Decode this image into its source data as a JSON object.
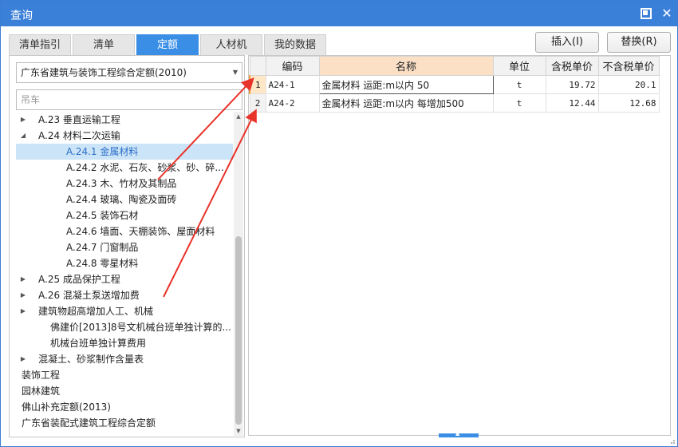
{
  "window": {
    "title": "查询"
  },
  "tabs": [
    {
      "label": "清单指引",
      "active": false
    },
    {
      "label": "清单",
      "active": false
    },
    {
      "label": "定额",
      "active": true
    },
    {
      "label": "人材机",
      "active": false
    },
    {
      "label": "我的数据",
      "active": false
    }
  ],
  "actions": {
    "insert_label": "插入(I)",
    "replace_label": "替换(R)"
  },
  "library": {
    "selected": "广东省建筑与装饰工程综合定额(2010)"
  },
  "search": {
    "value": "",
    "placeholder": "吊车"
  },
  "tree": [
    {
      "label": "A.23 垂直运输工程",
      "expander": "collapsed",
      "selected": false
    },
    {
      "label": "A.24 材料二次运输",
      "expander": "expanded",
      "selected": false
    },
    {
      "label": "A.24.1 金属材料",
      "expander": "none",
      "selected": true
    },
    {
      "label": "A.24.2 水泥、石灰、砂浆、砂、碎...",
      "expander": "none",
      "selected": false
    },
    {
      "label": "A.24.3 木、竹材及其制品",
      "expander": "none",
      "selected": false
    },
    {
      "label": "A.24.4 玻璃、陶瓷及面砖",
      "expander": "none",
      "selected": false
    },
    {
      "label": "A.24.5 装饰石材",
      "expander": "none",
      "selected": false
    },
    {
      "label": "A.24.6 墙面、天棚装饰、屋面材料",
      "expander": "none",
      "selected": false
    },
    {
      "label": "A.24.7 门窗制品",
      "expander": "none",
      "selected": false
    },
    {
      "label": "A.24.8 零星材料",
      "expander": "none",
      "selected": false
    },
    {
      "label": "A.25 成品保护工程",
      "expander": "collapsed",
      "selected": false
    },
    {
      "label": "A.26 混凝土泵送增加费",
      "expander": "collapsed",
      "selected": false
    },
    {
      "label": "建筑物超高增加人工、机械",
      "expander": "collapsed",
      "selected": false
    },
    {
      "label": "佛建价[2013]8号文机械台班单独计算的...",
      "expander": "none",
      "selected": false
    },
    {
      "label": "机械台班单独计算费用",
      "expander": "none",
      "selected": false
    },
    {
      "label": "混凝土、砂浆制作含量表",
      "expander": "collapsed",
      "selected": false
    },
    {
      "label": "装饰工程",
      "expander": "collapsed",
      "selected": false
    },
    {
      "label": "园林建筑",
      "expander": "collapsed",
      "selected": false
    },
    {
      "label": "佛山补充定额(2013)",
      "expander": "collapsed",
      "selected": false
    },
    {
      "label": "广东省装配式建筑工程综合定额",
      "expander": "collapsed",
      "selected": false
    }
  ],
  "table": {
    "columns": [
      "",
      "编码",
      "名称",
      "单位",
      "含税单价",
      "不含税单价"
    ],
    "rows": [
      {
        "no": "1",
        "code": "A24-1",
        "name": "金属材料 运距:m以内 50",
        "unit": "t",
        "price_tax": "19.72",
        "price_notax": "20.1"
      },
      {
        "no": "2",
        "code": "A24-2",
        "name": "金属材料 运距:m以内 每增加500",
        "unit": "t",
        "price_tax": "12.44",
        "price_notax": "12.68"
      }
    ]
  },
  "colors": {
    "titlebar": "#3a7fd8",
    "tab_active": "#3a8ee6",
    "selected_row": "#cce4f7",
    "annotation_arrow": "#e8332a"
  }
}
